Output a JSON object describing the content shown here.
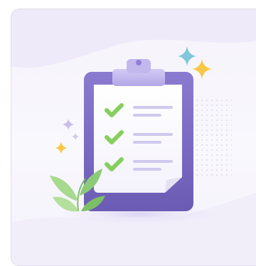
{
  "illustration": {
    "subject": "clipboard-checklist",
    "checklist_items": [
      {
        "checked": true
      },
      {
        "checked": true
      },
      {
        "checked": true
      }
    ]
  },
  "colors": {
    "clipboard_frame": "#7d6cc4",
    "clip": "#c2b7ee",
    "paper": "#ffffff",
    "check": "#86cf5e",
    "line": "#cfc9ee",
    "sparkle_yellow": "#f6c845",
    "sparkle_teal": "#7fc8da",
    "sparkle_purple": "#c9bde9",
    "leaf": "#8dca78",
    "background": "#f6f3fc"
  }
}
